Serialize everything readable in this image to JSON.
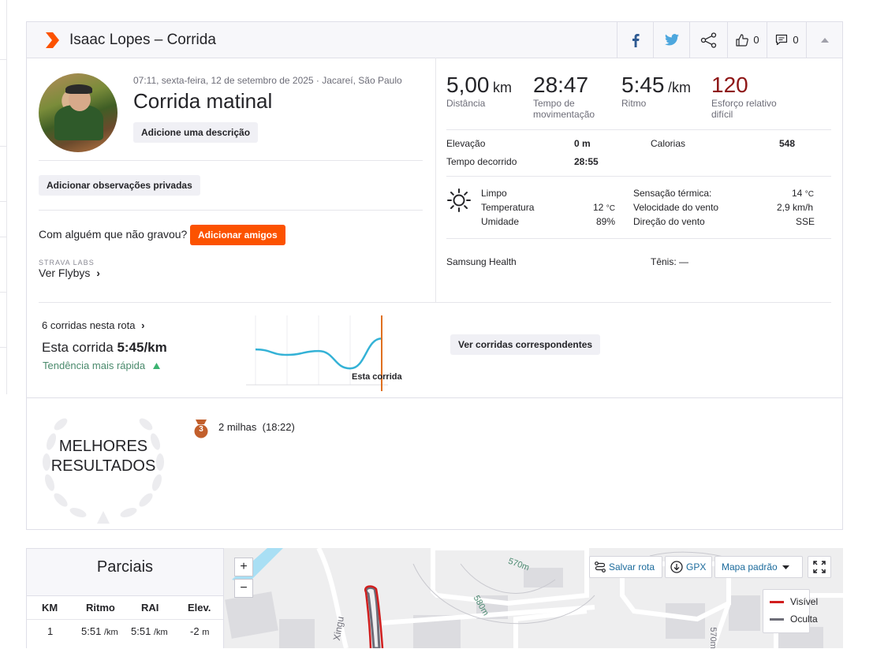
{
  "header": {
    "title": "Isaac Lopes – Corrida",
    "likes": "0",
    "comments": "0"
  },
  "activity": {
    "meta": "07:11, sexta-feira, 12 de setembro de 2025 · Jacareí, São Paulo",
    "name": "Corrida matinal",
    "add_description": "Adicione uma descrição",
    "add_private_notes": "Adicionar observações privadas",
    "with_someone": "Com alguém que não gravou?",
    "add_friends": "Adicionar amigos",
    "labs": "STRAVA LABS",
    "flybys": "Ver Flybys",
    "flybys_chevron": "›"
  },
  "stats": [
    {
      "value": "5,00",
      "unit": "km",
      "label": "Distância",
      "color": "#242428"
    },
    {
      "value": "28:47",
      "unit": "",
      "label": "Tempo de movimentação",
      "color": "#242428"
    },
    {
      "value": "5:45",
      "unit": "/km",
      "label": "Ritmo",
      "color": "#242428"
    },
    {
      "value": "120",
      "unit": "",
      "label": "Esforço relativo difícil",
      "color": "#8e1616"
    }
  ],
  "details": {
    "elevation_label": "Elevação",
    "elevation_value": "0 m",
    "calories_label": "Calorias",
    "calories_value": "548",
    "elapsed_label": "Tempo decorrido",
    "elapsed_value": "28:55"
  },
  "weather": {
    "icon": "sun-icon",
    "condition": "Limpo",
    "temp_label": "Temperatura",
    "temp_value": "12",
    "humidity_label": "Umidade",
    "humidity_value": "89%",
    "feels_label": "Sensação térmica:",
    "feels_value": "14",
    "wind_speed_label": "Velocidade do vento",
    "wind_speed_value": "2,9 km/h",
    "wind_dir_label": "Direção do vento",
    "wind_dir_value": "SSE",
    "deg_unit": "°C"
  },
  "device": {
    "device_name": "Samsung Health",
    "shoes": "Tênis: —"
  },
  "route": {
    "count": "6 corridas nesta rota",
    "chevron": "›",
    "this_run_label": "Esta corrida",
    "this_run_pace": "5:45/km",
    "trend": "Tendência mais rápida",
    "marker_label": "Esta corrida",
    "view_matching": "Ver corridas correspondentes"
  },
  "best": {
    "badge_line1": "MELHORES",
    "badge_line2": "RESULTADOS",
    "medal_rank": "3",
    "effort": "2 milhas",
    "effort_time": "(18:22)"
  },
  "splits": {
    "title": "Parciais",
    "columns": [
      "KM",
      "Ritmo",
      "RAI",
      "Elev."
    ],
    "rows": [
      {
        "km": "1",
        "pace": "5:51",
        "pace_unit": "/km",
        "gap": "5:51",
        "gap_unit": "/km",
        "elev": "-2",
        "elev_unit": "m"
      }
    ]
  },
  "map": {
    "zoom_in": "+",
    "zoom_out": "−",
    "save_route": "Salvar rota",
    "gpx": "GPX",
    "map_style": "Mapa padrão",
    "legend_visible": "Visível",
    "legend_hidden": "Oculta",
    "street_label": "Xingu",
    "contour_labels": [
      "570m",
      "580m",
      "570m"
    ],
    "route_color": "#d11e1e",
    "hidden_color": "#6d6d78"
  },
  "colors": {
    "brand_orange": "#fc5200",
    "trend_line": "#34b2d6",
    "marker_line": "#e07020",
    "trend_up": "#3cb371"
  },
  "chart_data": {
    "type": "line",
    "series": [
      {
        "values": [
          5.95,
          6.05,
          5.98,
          6.3,
          5.75
        ]
      }
    ]
  }
}
